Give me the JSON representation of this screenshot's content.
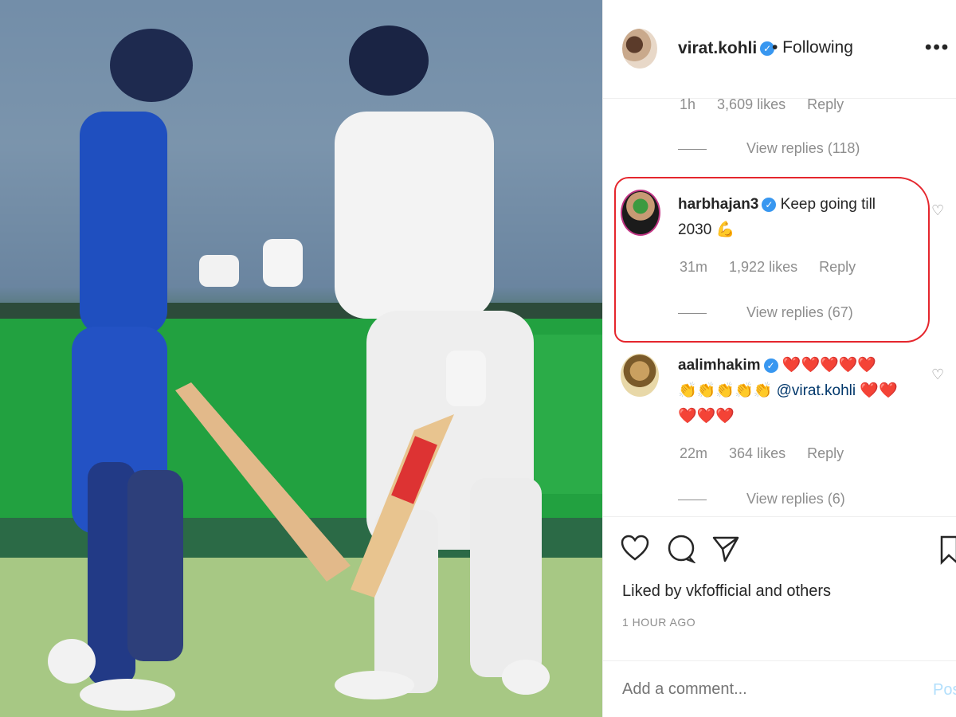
{
  "header": {
    "username": "virat.kohli",
    "follow_status": "• Following",
    "more": "•••"
  },
  "prev_comment": {
    "time": "1h",
    "likes": "3,609 likes",
    "reply": "Reply",
    "view_replies": "View replies (118)"
  },
  "highlight_comment": {
    "username": "harbhajan3",
    "text": "Keep going till 2030 💪",
    "time": "31m",
    "likes": "1,922 likes",
    "reply": "Reply",
    "view_replies": "View replies (67)"
  },
  "third_comment": {
    "username": "aalimhakim",
    "emoji_line1": "❤️❤️❤️❤️❤️",
    "emoji_line2a": "👏👏👏👏👏",
    "mention": "@virat.kohli",
    "emoji_line2b": "❤️❤️",
    "emoji_line3": "❤️❤️❤️",
    "time": "22m",
    "likes": "364 likes",
    "reply": "Reply",
    "view_replies": "View replies (6)"
  },
  "actions": {
    "liked_by": "Liked by vkfofficial and others",
    "time_ago": "1 HOUR AGO",
    "comment_placeholder": "Add a comment...",
    "post_label": "Post"
  },
  "icons": [
    "heart-icon",
    "comment-icon",
    "share-icon",
    "bookmark-icon",
    "verified-icon"
  ],
  "colors": {
    "verified": "#3897f0",
    "highlight": "#e5262d",
    "post": "#b2dffc"
  }
}
